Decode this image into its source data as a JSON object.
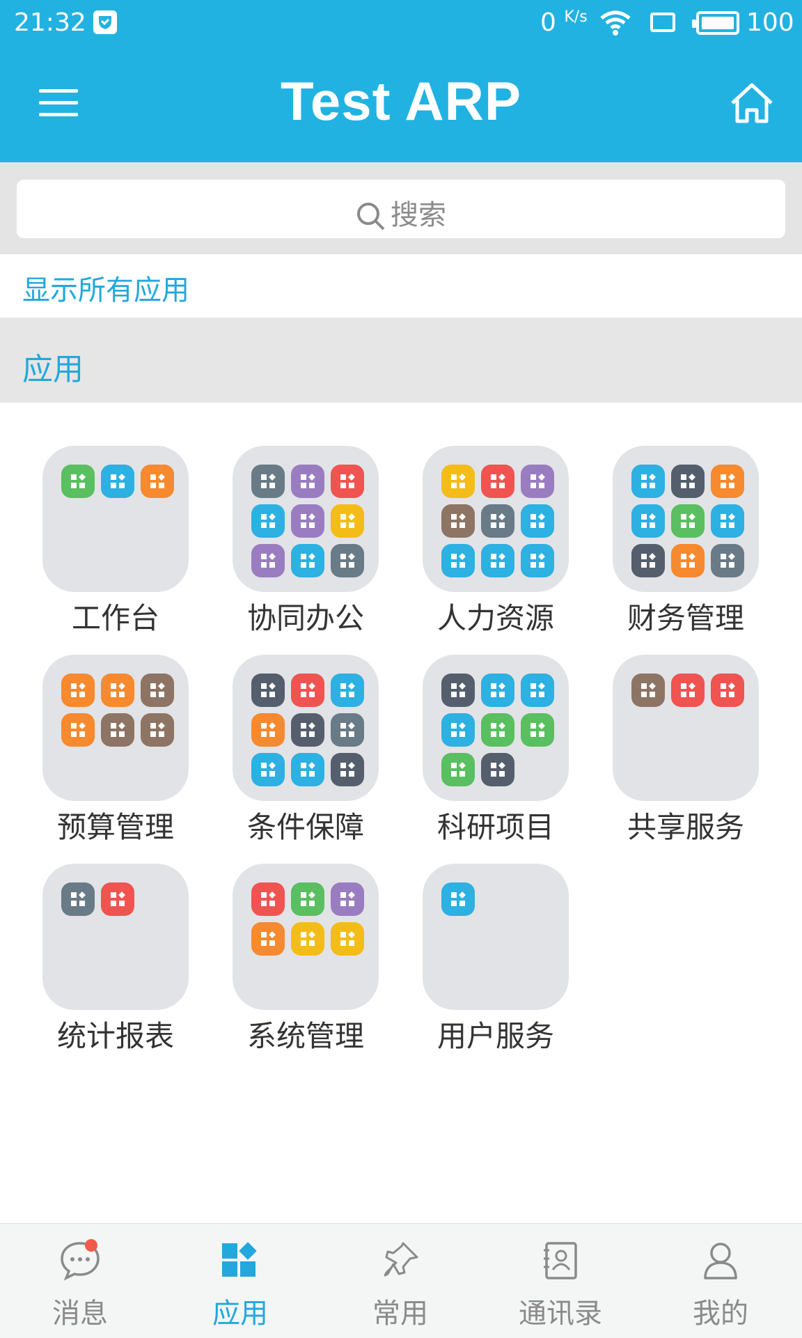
{
  "status": {
    "time": "21:32",
    "speed": "0",
    "speed_unit": "K/s",
    "battery": "100"
  },
  "header": {
    "title": "Test ARP"
  },
  "search": {
    "placeholder": "搜索"
  },
  "show_all": "显示所有应用",
  "section_title": "应用",
  "folders": [
    {
      "label": "工作台",
      "icons": [
        [
          "list-icon",
          "#59bf60"
        ],
        [
          "grid-icon",
          "#2db0e2"
        ],
        [
          "grid-icon",
          "#f7892e"
        ]
      ]
    },
    {
      "label": "协同办公",
      "icons": [
        [
          "calendar-icon",
          "#687b86"
        ],
        [
          "meeting-icon",
          "#9a7dc0"
        ],
        [
          "car-icon",
          "#ef5451"
        ],
        [
          "grid-icon",
          "#2db0e2"
        ],
        [
          "clipboard-icon",
          "#9a7dc0"
        ],
        [
          "laptop-icon",
          "#f4bc19"
        ],
        [
          "note-icon",
          "#9a7dc0"
        ],
        [
          "question-icon",
          "#2db0e2"
        ],
        [
          "question-icon",
          "#687b86"
        ]
      ]
    },
    {
      "label": "人力资源",
      "icons": [
        [
          "org-icon",
          "#f4bc19"
        ],
        [
          "team-icon",
          "#ef5451"
        ],
        [
          "clock-user-icon",
          "#9a7dc0"
        ],
        [
          "plane-icon",
          "#8d7464"
        ],
        [
          "alarm-icon",
          "#687b86"
        ],
        [
          "grid-icon",
          "#2db0e2"
        ],
        [
          "grid-icon",
          "#2db0e2"
        ],
        [
          "grid-icon",
          "#2db0e2"
        ],
        [
          "grid-icon",
          "#2db0e2"
        ]
      ]
    },
    {
      "label": "财务管理",
      "icons": [
        [
          "yen-hand-icon",
          "#2db0e2"
        ],
        [
          "receipt-icon",
          "#555e6c"
        ],
        [
          "coin-doc-icon",
          "#f7892e"
        ],
        [
          "share-icon",
          "#2db0e2"
        ],
        [
          "yen-doc-icon",
          "#59bf60"
        ],
        [
          "grid-icon",
          "#2db0e2"
        ],
        [
          "gear-icon",
          "#555e6c"
        ],
        [
          "database-icon",
          "#f7892e"
        ],
        [
          "stamp-icon",
          "#687b86"
        ]
      ]
    },
    {
      "label": "预算管理",
      "icons": [
        [
          "flag-icon",
          "#f7892e"
        ],
        [
          "card-icon",
          "#f7892e"
        ],
        [
          "org-icon",
          "#8d7464"
        ],
        [
          "hand-icon",
          "#f7892e"
        ],
        [
          "bar-chart-icon",
          "#8d7464"
        ],
        [
          "gear-icon",
          "#8d7464"
        ]
      ]
    },
    {
      "label": "条件保障",
      "icons": [
        [
          "flask-icon",
          "#555e6c"
        ],
        [
          "monitor-icon",
          "#ef5451"
        ],
        [
          "grid-icon",
          "#2db0e2"
        ],
        [
          "cart-icon",
          "#f7892e"
        ],
        [
          "yen-doc-icon",
          "#555e6c"
        ],
        [
          "laptop-icon",
          "#687b86"
        ],
        [
          "grid-icon",
          "#2db0e2"
        ],
        [
          "grid-icon",
          "#2db0e2"
        ],
        [
          "gear-icon",
          "#555e6c"
        ]
      ]
    },
    {
      "label": "科研项目",
      "icons": [
        [
          "layers-icon",
          "#555e6c"
        ],
        [
          "grid-icon",
          "#2db0e2"
        ],
        [
          "grid-icon",
          "#2db0e2"
        ],
        [
          "grid-icon",
          "#2db0e2"
        ],
        [
          "bar-chart-icon",
          "#59bf60"
        ],
        [
          "meeting-icon",
          "#59bf60"
        ],
        [
          "trophy-icon",
          "#59bf60"
        ],
        [
          "bar-chart-icon",
          "#555e6c"
        ]
      ]
    },
    {
      "label": "共享服务",
      "icons": [
        [
          "laptop-icon",
          "#8d7464"
        ],
        [
          "cloud-icon",
          "#ef5451"
        ],
        [
          "monitor-icon",
          "#ef5451"
        ]
      ]
    },
    {
      "label": "统计报表",
      "icons": [
        [
          "flag-icon",
          "#687b86"
        ],
        [
          "calculator-icon",
          "#ef5451"
        ]
      ]
    },
    {
      "label": "系统管理",
      "icons": [
        [
          "grid-icon",
          "#ef5451"
        ],
        [
          "wrench-icon",
          "#59bf60"
        ],
        [
          "users-icon",
          "#9a7dc0"
        ],
        [
          "shield-icon",
          "#f7892e"
        ],
        [
          "stamp-icon",
          "#f4bc19"
        ],
        [
          "bar-chart-icon",
          "#f4bc19"
        ]
      ]
    },
    {
      "label": "用户服务",
      "icons": [
        [
          "grid-icon",
          "#2db0e2"
        ]
      ]
    }
  ],
  "tabs": [
    {
      "label": "消息",
      "icon": "chat-icon"
    },
    {
      "label": "应用",
      "icon": "apps-icon"
    },
    {
      "label": "常用",
      "icon": "pin-icon"
    },
    {
      "label": "通讯录",
      "icon": "contacts-icon"
    },
    {
      "label": "我的",
      "icon": "profile-icon"
    }
  ],
  "colors": {
    "brand": "#22b2e2",
    "accent_text": "#22a8dc",
    "badge": "#f25b4b"
  }
}
